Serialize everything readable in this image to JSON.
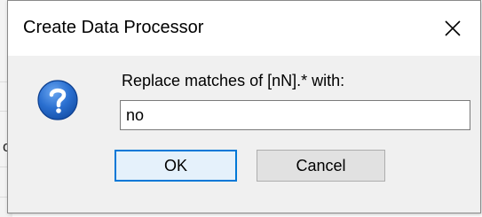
{
  "background": {
    "glyph": "o"
  },
  "dialog": {
    "title": "Create Data Processor",
    "close_icon": "close-icon",
    "icon": "question-icon",
    "prompt": "Replace matches of [nN].* with:",
    "input_value": "no",
    "ok_label": "OK",
    "cancel_label": "Cancel"
  },
  "colors": {
    "dialog_bg": "#f0f0f0",
    "titlebar_bg": "#ffffff",
    "accent": "#0078d7",
    "ok_bg": "#e5f1fb",
    "cancel_bg": "#e1e1e1",
    "icon_blue": "#1e64c8"
  }
}
